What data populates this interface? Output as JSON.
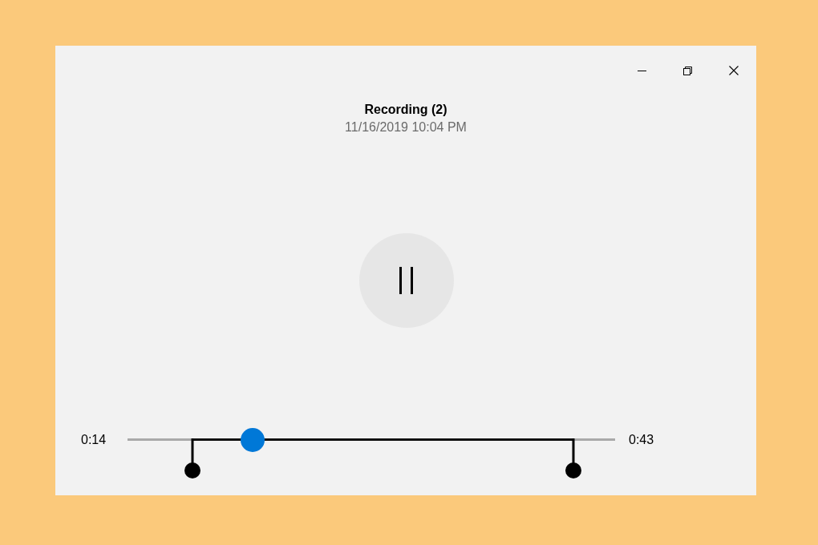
{
  "recording": {
    "title": "Recording (2)",
    "timestamp": "11/16/2019 10:04 PM"
  },
  "playback": {
    "playing": true
  },
  "timeline": {
    "start_time": "0:14",
    "end_time": "0:43",
    "level": 0.257,
    "trim_handles": [
      {
        "level": 0.134
      },
      {
        "level": 0.914
      }
    ]
  }
}
